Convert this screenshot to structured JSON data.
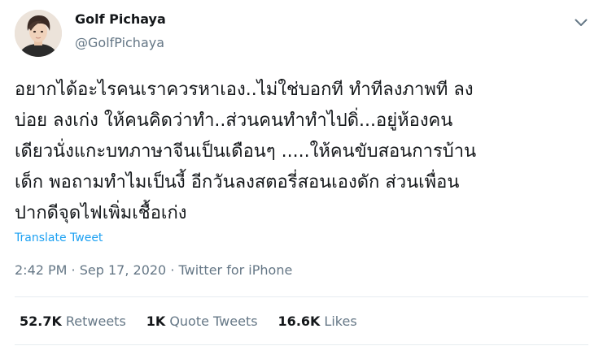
{
  "user": {
    "display_name": "Golf Pichaya",
    "handle": "@GolfPichaya"
  },
  "tweet": {
    "text": "อยากได้อะไรคนเราควรหาเอง..ไม่ใช่บอกที ทำทีลงภาพที ลง\nบ่อย ลงเก่ง ให้คนคิดว่าทำ..ส่วนคนทำทำไปดิ่...อยู่ห้องคน\nเดียวนั่งแกะบทภาษาจีนเป็นเดือนๆ .....ให้คนขับสอนการบ้าน\nเด็ก พอถามทำไมเป็นงี้ อีกวันลงสตอรี่สอนเองดัก ส่วนเพื่อน\nปากดีจุดไฟเพิ่มเชื้อเก่ง",
    "translate_label": "Translate Tweet"
  },
  "meta": {
    "time": "2:42 PM",
    "separator": " · ",
    "date": "Sep 17, 2020",
    "source": "Twitter for iPhone"
  },
  "stats": {
    "retweets_count": "52.7K",
    "retweets_label": "Retweets",
    "quotes_count": "1K",
    "quotes_label": "Quote Tweets",
    "likes_count": "16.6K",
    "likes_label": "Likes"
  },
  "icons": {
    "caret": "chevron-down-icon",
    "avatar": "avatar"
  },
  "colors": {
    "link": "#1da1f2",
    "secondary_text": "#657786",
    "primary_text": "#14171a",
    "divider": "#e6ecf0"
  }
}
